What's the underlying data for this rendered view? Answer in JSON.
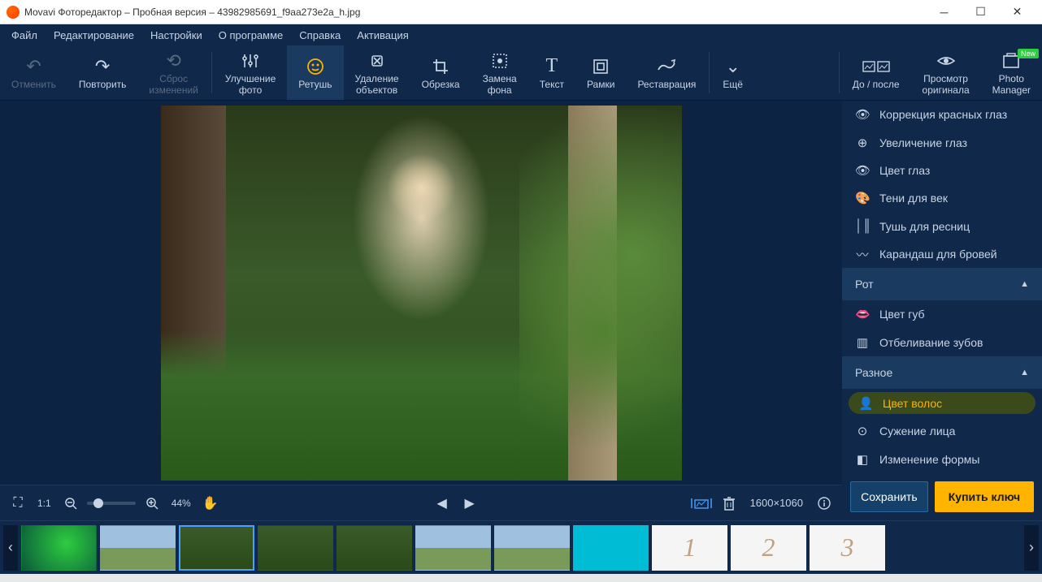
{
  "titlebar": {
    "title": "Movavi Фоторедактор – Пробная версия – 43982985691_f9aa273e2a_h.jpg"
  },
  "menubar": {
    "items": [
      "Файл",
      "Редактирование",
      "Настройки",
      "О программе",
      "Справка",
      "Активация"
    ]
  },
  "toolbar": {
    "undo": "Отменить",
    "redo": "Повторить",
    "reset": "Сброс\nизменений",
    "enhance": "Улучшение\nфото",
    "retouch": "Ретушь",
    "remove_objects": "Удаление\nобъектов",
    "crop": "Обрезка",
    "replace_bg": "Замена\nфона",
    "text": "Текст",
    "frames": "Рамки",
    "restore": "Реставрация",
    "more": "Ещё",
    "before_after": "До / после",
    "view_original": "Просмотр\nоригинала",
    "photo_manager": "Photo\nManager",
    "new_badge": "New"
  },
  "side_panel": {
    "items_eyes": [
      "Коррекция красных глаз",
      "Увеличение глаз",
      "Цвет глаз",
      "Тени для век",
      "Тушь для ресниц",
      "Карандаш для бровей"
    ],
    "section_mouth": "Рот",
    "items_mouth": [
      "Цвет губ",
      "Отбеливание зубов"
    ],
    "section_misc": "Разное",
    "items_misc": [
      "Цвет волос",
      "Сужение лица",
      "Изменение формы"
    ],
    "save": "Сохранить",
    "buy": "Купить ключ"
  },
  "canvas_controls": {
    "fit_label": "1:1",
    "zoom_percent": "44%",
    "dimensions": "1600×1060"
  },
  "filmstrip": {
    "thumbs": [
      {
        "kind": "logo"
      },
      {
        "kind": "house"
      },
      {
        "kind": "girl",
        "selected": true
      },
      {
        "kind": "girl"
      },
      {
        "kind": "girl"
      },
      {
        "kind": "house"
      },
      {
        "kind": "house"
      },
      {
        "kind": "pin"
      },
      {
        "kind": "num",
        "label": "1"
      },
      {
        "kind": "num",
        "label": "2"
      },
      {
        "kind": "num",
        "label": "3"
      }
    ]
  }
}
